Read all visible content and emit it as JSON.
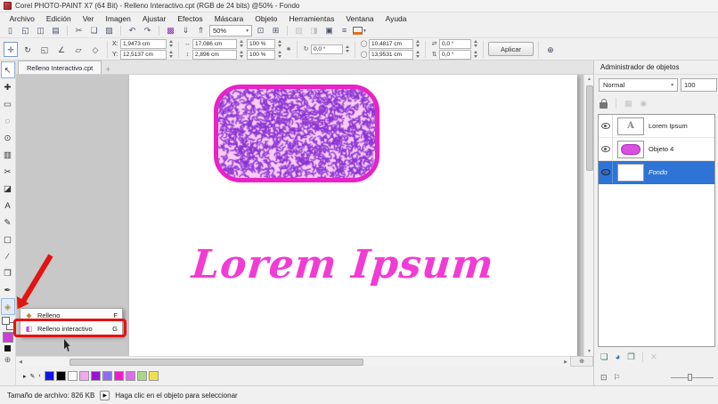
{
  "window": {
    "title": "Corel PHOTO-PAINT X7 (64 Bit) - Relleno Interactivo.cpt (RGB de 24 bits) @50% - Fondo"
  },
  "menu": {
    "items": [
      "Archivo",
      "Edición",
      "Ver",
      "Imagen",
      "Ajustar",
      "Efectos",
      "Máscara",
      "Objeto",
      "Herramientas",
      "Ventana",
      "Ayuda"
    ]
  },
  "std_toolbar": {
    "zoom_value": "50%",
    "icons": [
      {
        "name": "new",
        "glyph": "▯"
      },
      {
        "name": "open",
        "glyph": "◱"
      },
      {
        "name": "save",
        "glyph": "◫"
      },
      {
        "name": "print",
        "glyph": "▤"
      },
      {
        "name": "cut",
        "glyph": "✂"
      },
      {
        "name": "copy",
        "glyph": "❏"
      },
      {
        "name": "paste",
        "glyph": "▨"
      },
      {
        "name": "undo",
        "glyph": "↶"
      },
      {
        "name": "redo",
        "glyph": "↷"
      },
      {
        "name": "image-adjustment-lab",
        "glyph": "▩"
      },
      {
        "name": "import",
        "glyph": "⇓"
      },
      {
        "name": "export",
        "glyph": "⇑"
      }
    ],
    "icons_right": [
      {
        "name": "full-screen-preview",
        "glyph": "⊡"
      },
      {
        "name": "show-rulers",
        "glyph": "⊞"
      },
      {
        "name": "hide-mask-marquee",
        "glyph": "▧"
      },
      {
        "name": "invert-mask",
        "glyph": "◨"
      },
      {
        "name": "object-marquee",
        "glyph": "▣"
      },
      {
        "name": "align",
        "glyph": "≡"
      }
    ]
  },
  "property_bar": {
    "tools": [
      {
        "name": "position",
        "glyph": "✛"
      },
      {
        "name": "rotate",
        "glyph": "↻"
      },
      {
        "name": "scale",
        "glyph": "◱"
      },
      {
        "name": "skew",
        "glyph": "∠"
      },
      {
        "name": "distort",
        "glyph": "▱"
      },
      {
        "name": "perspective",
        "glyph": "◇"
      }
    ],
    "x_label": "X:",
    "y_label": "Y:",
    "x_value": "1,9473 cm",
    "y_value": "12,5137 cm",
    "width_glyph": "↔",
    "height_glyph": "↕",
    "width_value": "17,086 cm",
    "height_value": "2,896 cm",
    "scale_h": "100 %",
    "scale_v": "100 %",
    "lock_glyph": "✱",
    "rotate_glyph": "↻",
    "rotation_value": "0,0 °",
    "center_glyph": "◯",
    "center_x": "10,4817 cm",
    "center_y": "13,9531 cm",
    "skew_h_glyph": "⇄",
    "skew_v_glyph": "⇅",
    "skew_h": "0,0 °",
    "skew_v": "0,0 °",
    "apply_label": "Aplicar",
    "apply_plus_glyph": "⊕"
  },
  "doc_tab": {
    "label": "Relleno Interactivo.cpt",
    "new_tab": "+"
  },
  "toolbox": {
    "tools": [
      {
        "name": "pick",
        "glyph": "↖"
      },
      {
        "name": "mask-transform",
        "glyph": "✚"
      },
      {
        "name": "rectangle-mask",
        "glyph": "▭"
      },
      {
        "name": "freehand-mask",
        "glyph": "◌"
      },
      {
        "name": "zoom",
        "glyph": "⊙"
      },
      {
        "name": "clone",
        "glyph": "▥"
      },
      {
        "name": "cutout-lab",
        "glyph": "✂"
      },
      {
        "name": "eraser",
        "glyph": "◪"
      },
      {
        "name": "text",
        "glyph": "A"
      },
      {
        "name": "paint",
        "glyph": "✎"
      },
      {
        "name": "rectangle",
        "glyph": "▢"
      },
      {
        "name": "line",
        "glyph": "∕"
      },
      {
        "name": "polygon",
        "glyph": "❒"
      },
      {
        "name": "eyedropper",
        "glyph": "✒"
      },
      {
        "name": "fill",
        "glyph": "◈"
      }
    ],
    "fg_color": "#cf3fd6",
    "plus_glyph": "⊕"
  },
  "canvas": {
    "text": "Lorem Ipsum",
    "text_color": "#f23bd4",
    "shape": {
      "border_color": "#e822c6",
      "fill_bg": "#f8ccf5",
      "fill_speckle": "#8c35d4"
    }
  },
  "flyout": {
    "items": [
      {
        "label": "Relleno",
        "shortcut": "F"
      },
      {
        "label": "Relleno interactivo",
        "shortcut": "G"
      }
    ]
  },
  "object_manager": {
    "title": "Administrador de objetos",
    "blend_mode": "Normal",
    "opacity": "100",
    "layers": [
      {
        "name": "Lorem Ipsum"
      },
      {
        "name": "Objeto 4",
        "thumb_color": "#d94fe0"
      },
      {
        "name": "Fondo"
      }
    ]
  },
  "palette": {
    "colors": [
      "#1414e0",
      "#000000",
      "#ffffff",
      "#f0a8ee",
      "#9a14d8",
      "#8e6cf0",
      "#f218d2",
      "#dd6ce8",
      "#a9d88c",
      "#f0e04a"
    ]
  },
  "status": {
    "file_size": "Tamaño de archivo: 826 KB",
    "hint": "Haga clic en el objeto para seleccionar"
  }
}
